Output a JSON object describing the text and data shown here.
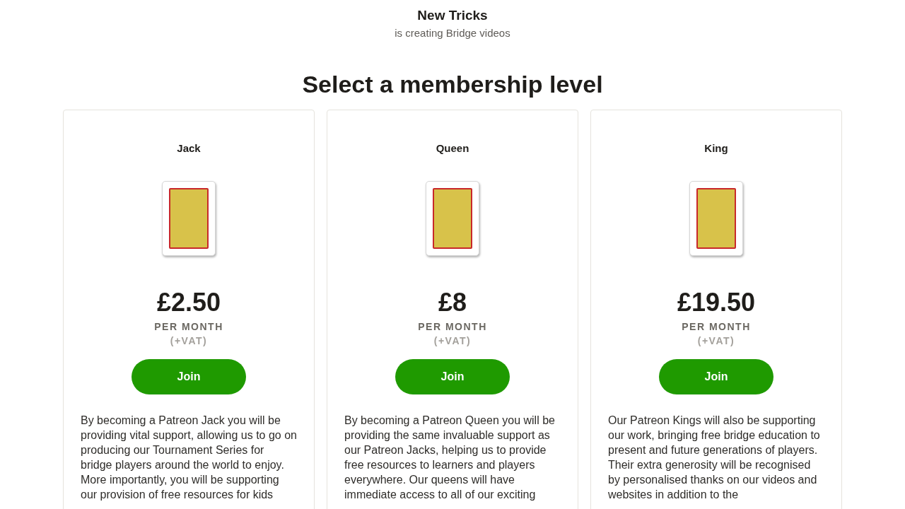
{
  "creator": {
    "name": "New Tricks",
    "subtitle": "is creating Bridge videos"
  },
  "heading": "Select a membership level",
  "tiers": [
    {
      "name": "Jack",
      "price": "£2.50",
      "period": "PER MONTH",
      "tax": "(+VAT)",
      "button": "Join",
      "description": "By becoming a Patreon Jack you will be providing vital support, allowing us to go on producing our Tournament Series for bridge players around the world to enjoy. More importantly, you will be supporting our provision of free resources for kids"
    },
    {
      "name": "Queen",
      "price": "£8",
      "period": "PER MONTH",
      "tax": "(+VAT)",
      "button": "Join",
      "description": "By becoming a Patreon Queen you will be providing the same invaluable support as our Patreon Jacks, helping us to provide free resources to learners and players everywhere. Our queens will have immediate access to all of our exciting"
    },
    {
      "name": "King",
      "price": "£19.50",
      "period": "PER MONTH",
      "tax": "(+VAT)",
      "button": "Join",
      "description": "Our Patreon Kings will also be supporting our work, bringing free bridge education to present and future generations of players.  Their extra generosity will be recognised by personalised thanks on our videos and websites in addition to the"
    }
  ]
}
